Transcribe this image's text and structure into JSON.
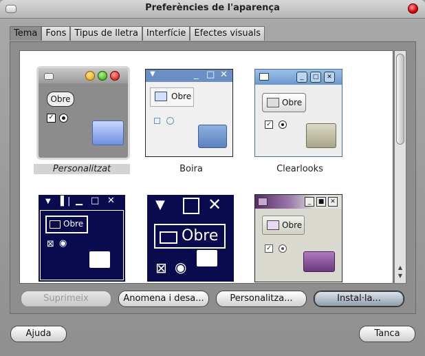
{
  "window": {
    "title": "Preferències de l'aparença"
  },
  "tabs": [
    {
      "label": "Tema"
    },
    {
      "label": "Fons"
    },
    {
      "label": "Tipus de lletra"
    },
    {
      "label": "Interfície"
    },
    {
      "label": "Efectes visuals"
    }
  ],
  "themes": [
    {
      "name": "Personalitzat",
      "preview_button": "Obre",
      "selected": true
    },
    {
      "name": "Boira",
      "preview_button": "Obre"
    },
    {
      "name": "Clearlooks",
      "preview_button": "Obre"
    },
    {
      "name": "",
      "preview_button": "Obre"
    },
    {
      "name": "",
      "preview_button": "Obre"
    },
    {
      "name": "",
      "preview_button": "Obre"
    }
  ],
  "actions": {
    "delete": "Suprimeix",
    "save_as": "Anomena i desa...",
    "customize": "Personalitza...",
    "install": "Instal·la..."
  },
  "footer": {
    "help": "Ajuda",
    "close": "Tanca"
  },
  "colors": {
    "accent": "#0a0a4e",
    "boira": "#6a8fc4",
    "purple": "#6a3a7a"
  }
}
